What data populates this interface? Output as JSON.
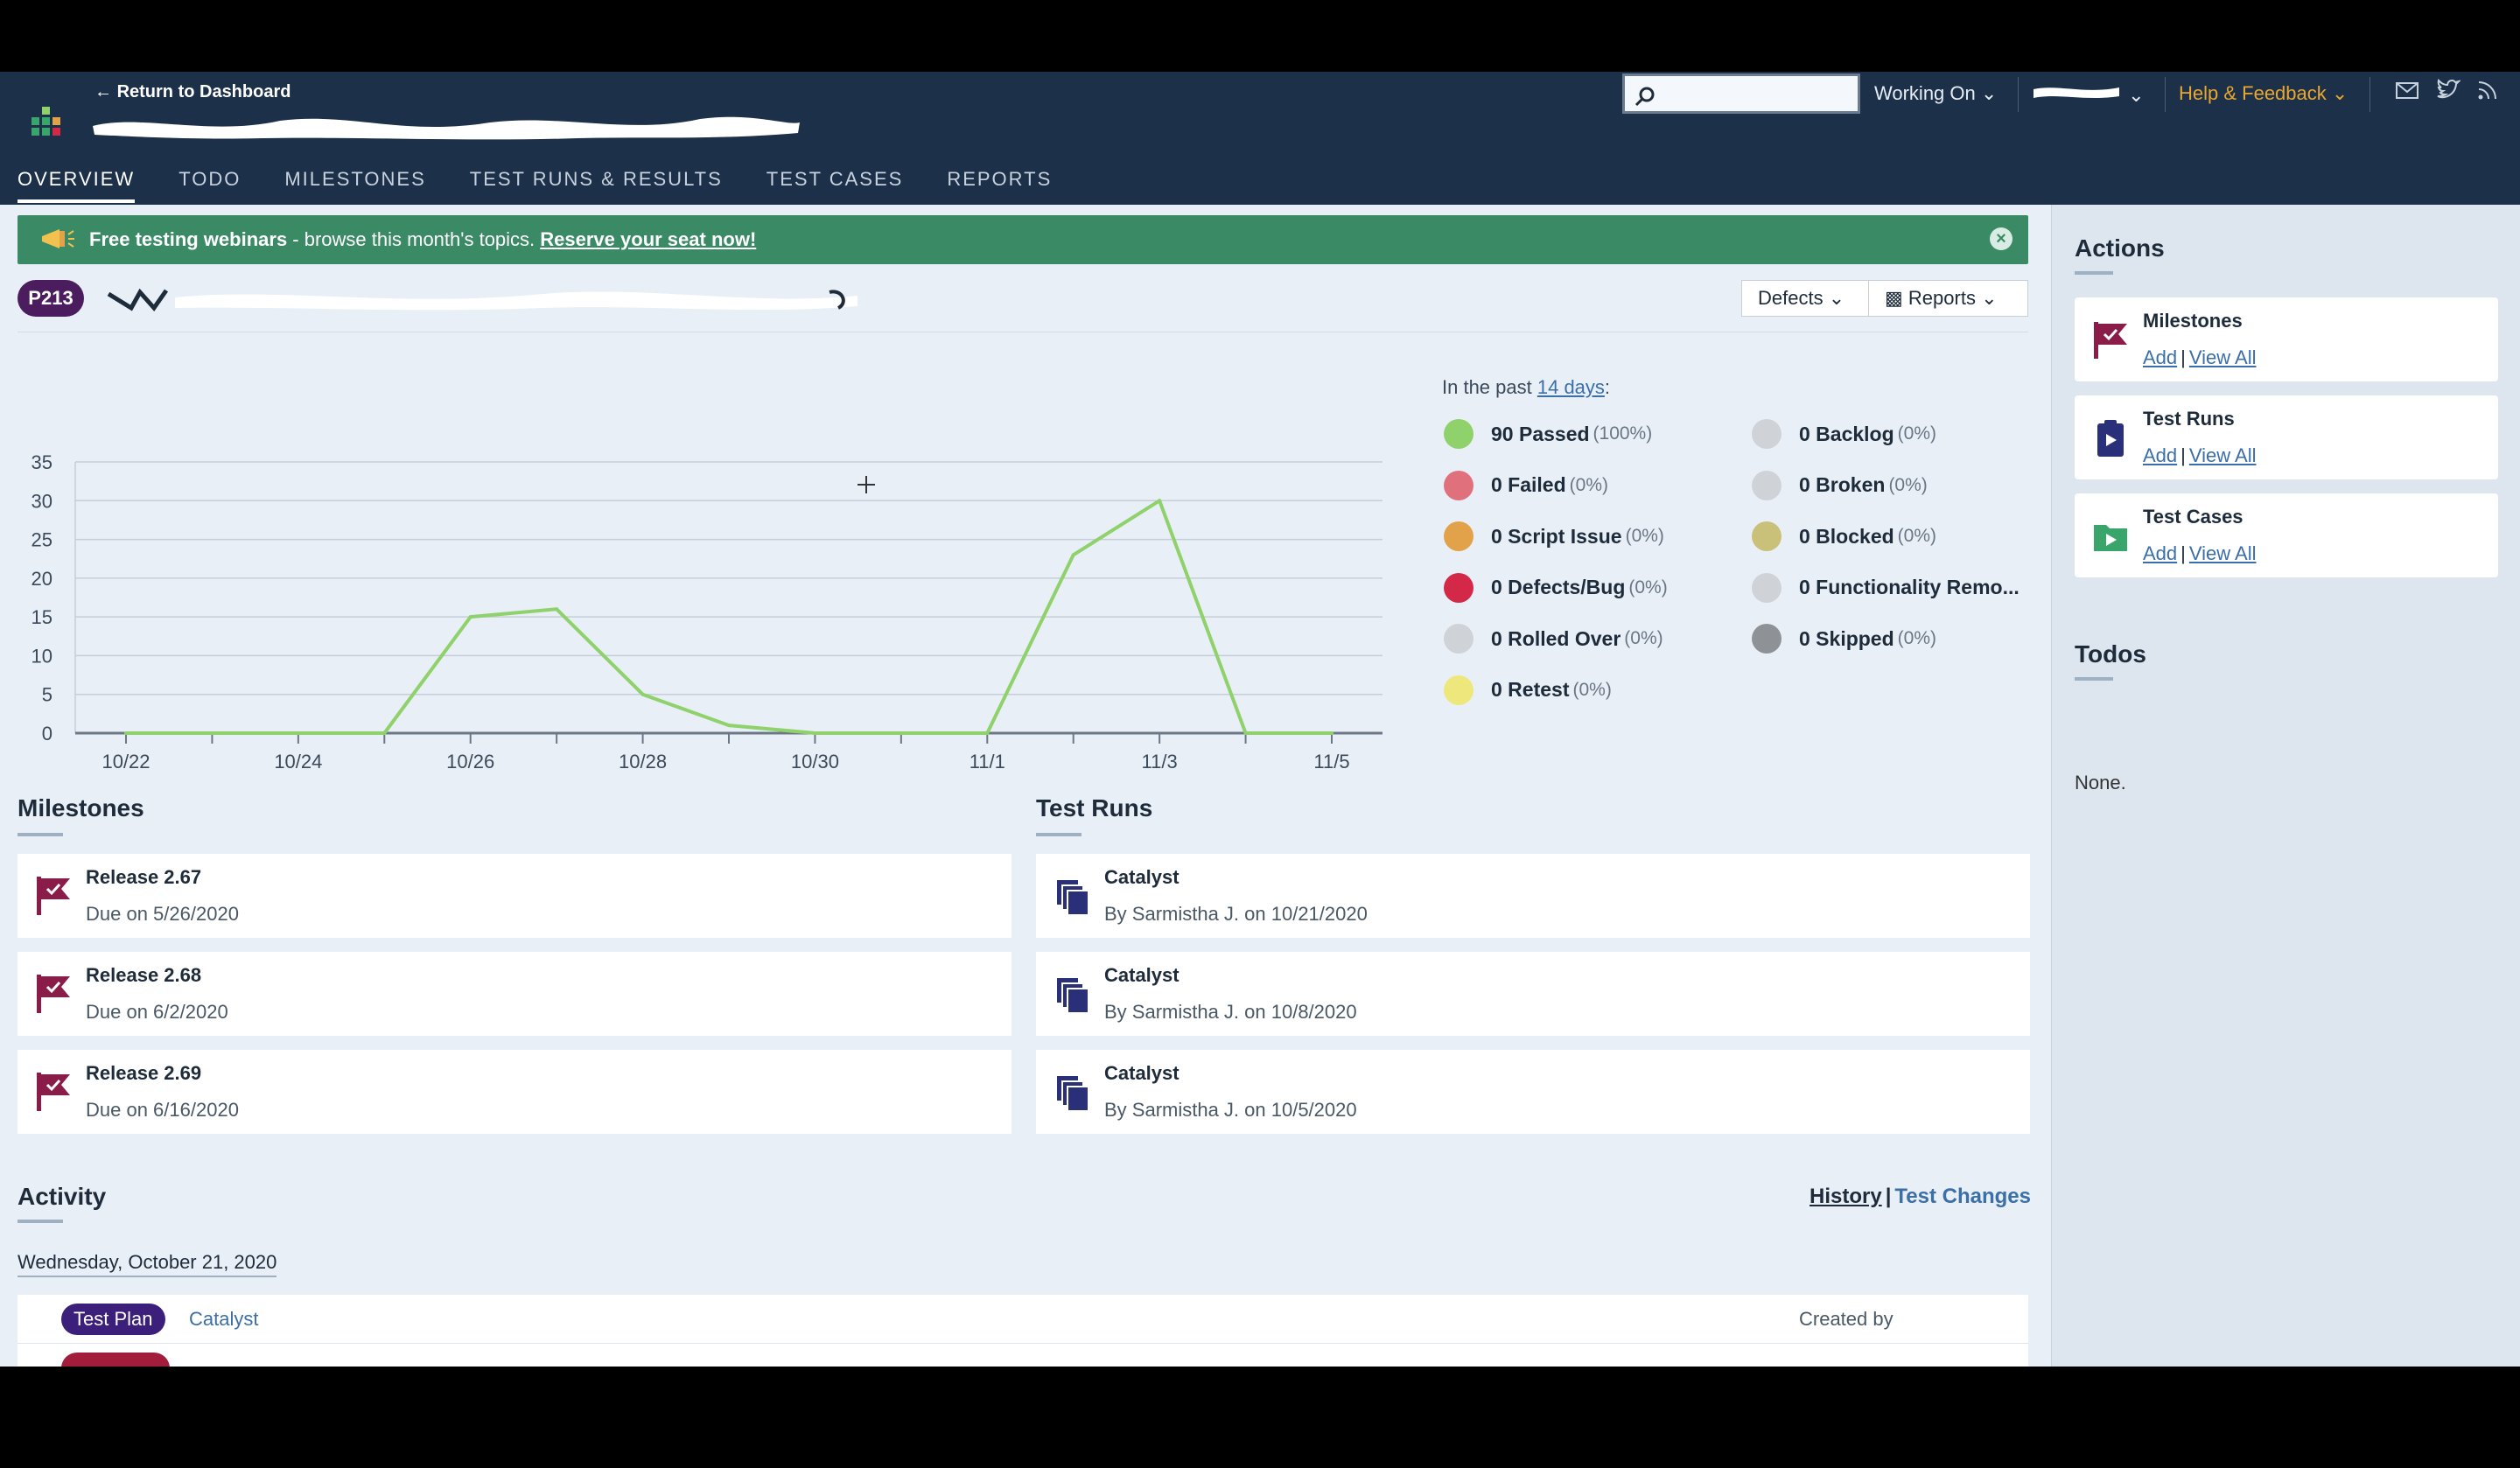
{
  "header": {
    "back_link": "Return to Dashboard",
    "tabs": [
      "OVERVIEW",
      "TODO",
      "MILESTONES",
      "TEST RUNS & RESULTS",
      "TEST CASES",
      "REPORTS"
    ],
    "search_placeholder": "",
    "working_on": "Working On",
    "help": "Help & Feedback",
    "icons": [
      "mail-icon",
      "twitter-icon",
      "rss-icon"
    ]
  },
  "banner": {
    "bold": "Free testing webinars",
    "middle": " - browse this month's topics. ",
    "link": "Reserve your seat now!"
  },
  "project": {
    "badge": "P213",
    "defects_label": "Defects",
    "reports_label": "Reports"
  },
  "chart_data": {
    "type": "line",
    "x": [
      "10/22",
      "10/23",
      "10/24",
      "10/25",
      "10/26",
      "10/27",
      "10/28",
      "10/29",
      "10/30",
      "10/31",
      "11/1",
      "11/2",
      "11/3",
      "11/4",
      "11/5"
    ],
    "tick_labels": [
      "10/22",
      "10/24",
      "10/26",
      "10/28",
      "10/30",
      "11/1",
      "11/3",
      "11/5"
    ],
    "y_ticks": [
      "35",
      "30",
      "25",
      "20",
      "15",
      "10",
      "5",
      "0"
    ],
    "ylim": [
      0,
      35
    ],
    "series": [
      {
        "color": "#8fd16a",
        "values": [
          0,
          0,
          0,
          0,
          15,
          16,
          5,
          1,
          0,
          0,
          0,
          23,
          30,
          0,
          0
        ]
      }
    ],
    "grid": true
  },
  "summary": {
    "prefix": "In the past ",
    "link": "14 days",
    "suffix": ":",
    "left": [
      {
        "count": "90 Passed",
        "pct": "(100%)",
        "color": "#8fd16a"
      },
      {
        "count": "0 Failed",
        "pct": "(0%)",
        "color": "#e0707c"
      },
      {
        "count": "0 Script Issue",
        "pct": "(0%)",
        "color": "#e2a24a"
      },
      {
        "count": "0 Defects/Bug",
        "pct": "(0%)",
        "color": "#d42848"
      },
      {
        "count": "0 Rolled Over",
        "pct": "(0%)",
        "color": "#cfd3d8"
      },
      {
        "count": "0 Retest",
        "pct": "(0%)",
        "color": "#eee87c"
      }
    ],
    "right": [
      {
        "count": "0 Backlog",
        "pct": "(0%)",
        "color": "#cfd3d8"
      },
      {
        "count": "0 Broken",
        "pct": "(0%)",
        "color": "#cfd3d8"
      },
      {
        "count": "0 Blocked",
        "pct": "(0%)",
        "color": "#c9c07a"
      },
      {
        "count": "0 Functionality Remo...",
        "pct": "",
        "color": "#cfd3d8"
      },
      {
        "count": "0 Skipped",
        "pct": "(0%)",
        "color": "#8e9296"
      }
    ]
  },
  "milestones": {
    "title": "Milestones",
    "items": [
      {
        "name": "Release 2.67",
        "due": "Due on 5/26/2020"
      },
      {
        "name": "Release 2.68",
        "due": "Due on 6/2/2020"
      },
      {
        "name": "Release 2.69",
        "due": "Due on 6/16/2020"
      }
    ]
  },
  "test_runs": {
    "title": "Test Runs",
    "items": [
      {
        "name": "Catalyst",
        "by": "By Sarmistha J. on 10/21/2020"
      },
      {
        "name": "Catalyst",
        "by": "By Sarmistha J. on 10/8/2020"
      },
      {
        "name": "Catalyst",
        "by": "By Sarmistha J. on 10/5/2020"
      }
    ]
  },
  "activity": {
    "title": "Activity",
    "history": "History",
    "sep": "|",
    "test_changes": "Test Changes",
    "date": "Wednesday, October 21, 2020",
    "rows": [
      {
        "type": "Test Plan",
        "link": "Catalyst",
        "by": "Created by"
      }
    ]
  },
  "sidebar": {
    "actions_title": "Actions",
    "actions": [
      {
        "title": "Milestones",
        "add": "Add",
        "sep": "|",
        "view": "View All"
      },
      {
        "title": "Test Runs",
        "add": "Add",
        "sep": "|",
        "view": "View All"
      },
      {
        "title": "Test Cases",
        "add": "Add",
        "sep": "|",
        "view": "View All"
      }
    ],
    "todos_title": "Todos",
    "todos_value": "None."
  }
}
